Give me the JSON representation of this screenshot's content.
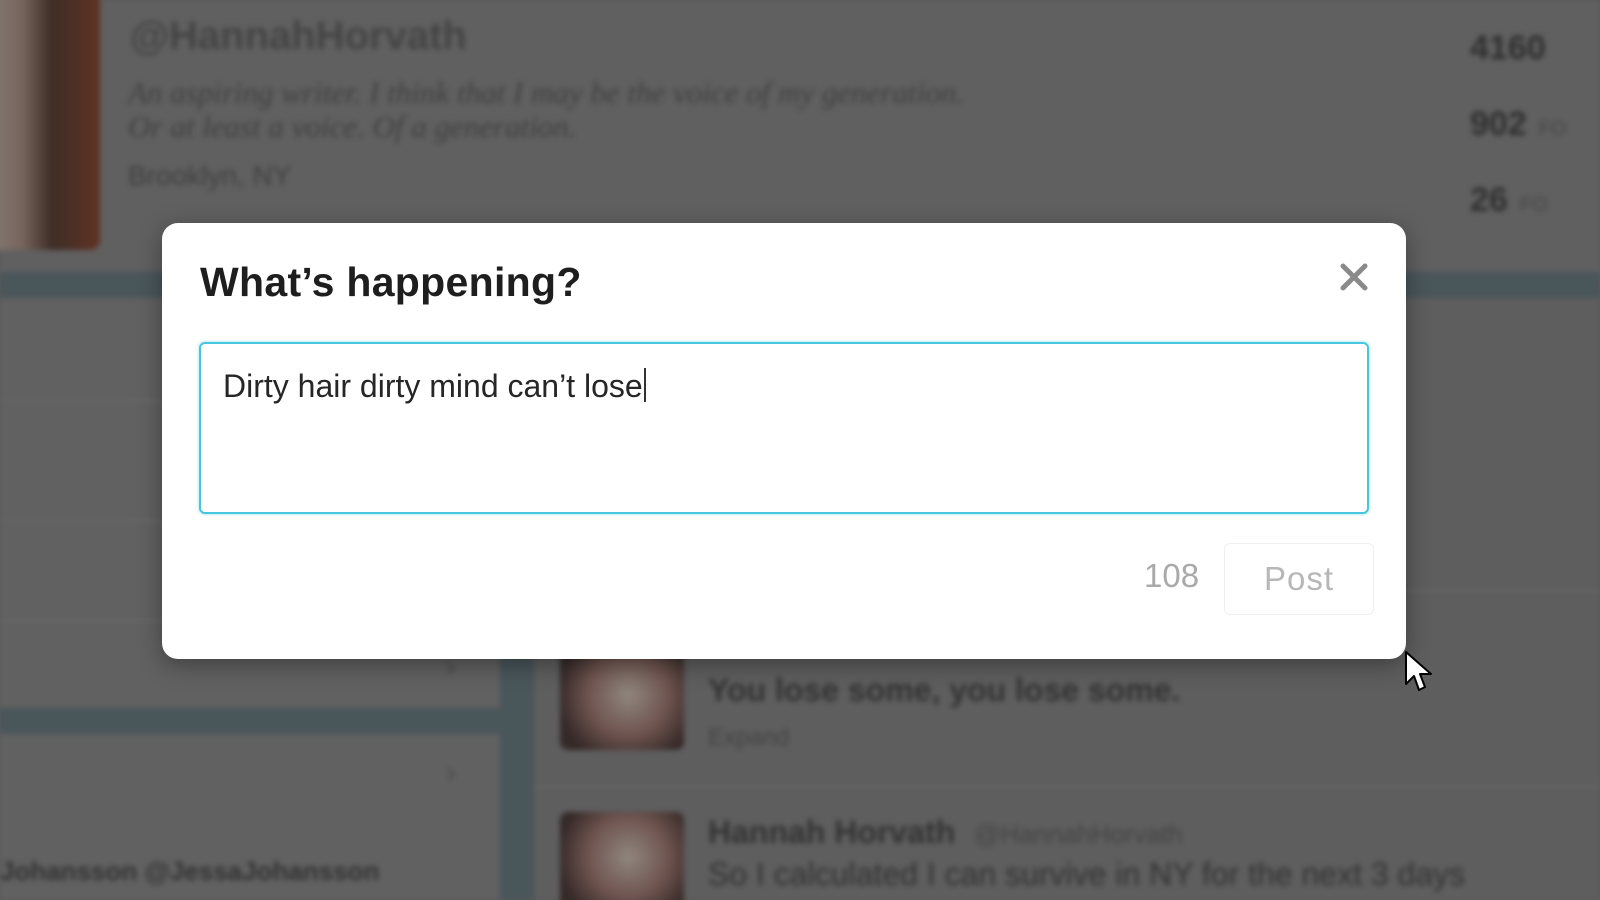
{
  "background": {
    "profile": {
      "handle": "@HannahHorvath",
      "bio": "An aspiring writer. I think that I may be the voice of my generation. Or at least a voice. Of a generation.",
      "location": "Brooklyn, NY",
      "stats": [
        {
          "value": "4160",
          "unit": ""
        },
        {
          "value": "902",
          "unit": "FO"
        },
        {
          "value": "26",
          "unit": "FO"
        }
      ]
    },
    "tweets": [
      {
        "text": "You lose some, you lose some.",
        "action": "Expand"
      },
      {
        "name": "Hannah Horvath",
        "handle": "@HannahHorvath",
        "text": "So I calculated I can survive in NY for the next 3 days"
      }
    ],
    "bottom_left_name": "Johansson @JessaJohansson"
  },
  "modal": {
    "title": "What’s happening?",
    "compose_text": "Dirty hair dirty mind can’t lose",
    "char_count": "108",
    "post_label": "Post"
  },
  "colors": {
    "focus_border": "#47c7dd",
    "disabled_text": "#b7b7b7",
    "title_text": "#1e1e1e"
  },
  "icons": {
    "close": "close-icon",
    "cursor": "arrow-cursor-icon"
  }
}
